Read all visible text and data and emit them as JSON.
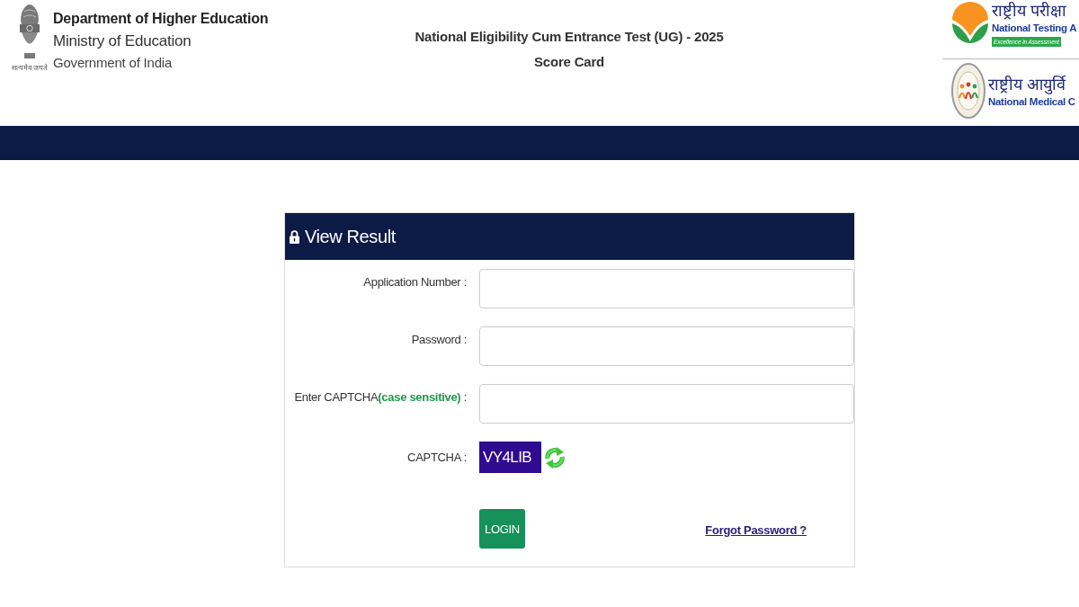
{
  "header": {
    "emblem": {
      "motto": "सत्यमेव जयते"
    },
    "department": "Department of Higher Education",
    "ministry": "Ministry of Education",
    "government": "Government of India",
    "title": "National Eligibility Cum Entrance Test (UG) - 2025",
    "subtitle": "Score Card",
    "logos": [
      {
        "kind": "tick",
        "hindi": "राष्ट्रीय परीक्षा",
        "english": "National Testing A",
        "tagline": "Excellence in Assessment"
      },
      {
        "kind": "seal",
        "hindi": "राष्ट्रीय आयुर्वि",
        "english": "National Medical C"
      }
    ]
  },
  "login_card": {
    "title": "View Result",
    "fields": [
      {
        "label": "Application Number :"
      },
      {
        "label": "Password :"
      },
      {
        "label": "Enter CAPTCHA**(case sensitive)** :"
      }
    ],
    "captcha": {
      "label": "CAPTCHA :",
      "code": "VY4LIB"
    },
    "login_button": "LOGIN",
    "forgot_link": "Forgot Password ?"
  }
}
